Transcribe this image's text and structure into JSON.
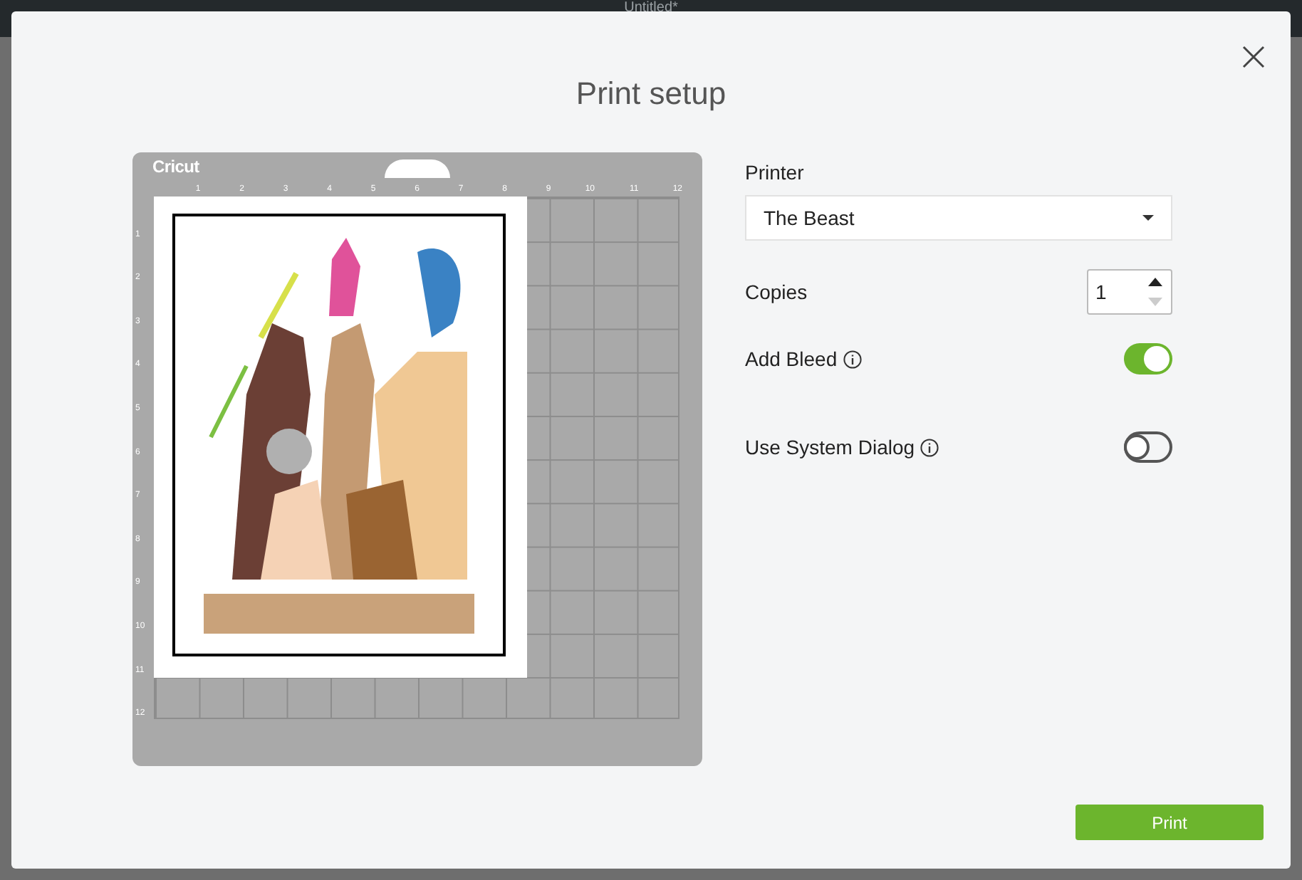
{
  "app_title": "Untitled*",
  "dialog": {
    "title": "Print setup"
  },
  "mat": {
    "brand": "Cricut",
    "top_ruler": [
      "1",
      "2",
      "3",
      "4",
      "5",
      "6",
      "7",
      "8",
      "9",
      "10",
      "11",
      "12"
    ],
    "left_ruler": [
      "1",
      "2",
      "3",
      "4",
      "5",
      "6",
      "7",
      "8",
      "9",
      "10",
      "11",
      "12"
    ]
  },
  "printer": {
    "label": "Printer",
    "value": "The Beast"
  },
  "copies": {
    "label": "Copies",
    "value": "1"
  },
  "toggles": [
    {
      "label": "Add Bleed",
      "on": true
    },
    {
      "label": "Use System Dialog",
      "on": false
    }
  ],
  "print_button": "Print"
}
